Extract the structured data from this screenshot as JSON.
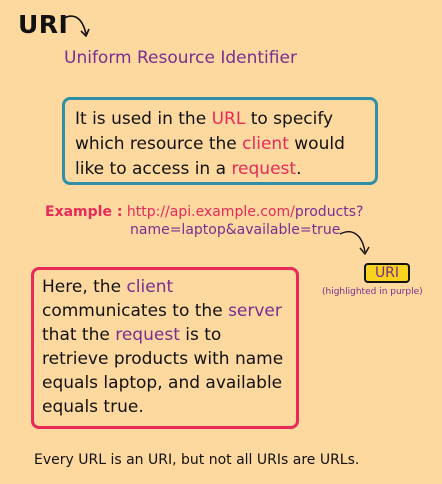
{
  "title": "URI",
  "subtitle": "Uniform Resource Identifier",
  "box1": {
    "t1": "It is used in the ",
    "url": "URL",
    "t2": " to specify which resource the ",
    "client": "client",
    "t3": " would like to access in a ",
    "request": "request",
    "t4": "."
  },
  "example": {
    "label": "Example :",
    "url_part1": "http://api.example.com/",
    "url_part2": "products?",
    "url_line2": "name=laptop&available=true"
  },
  "uri_badge": {
    "label": "URI",
    "note": "(highlighted in purple)"
  },
  "box2": {
    "t1": "Here, the ",
    "client": "client",
    "t2": " communicates to the ",
    "server": "server",
    "t3": " that the ",
    "request": "request",
    "t4": " is to retrieve products with name equals laptop, and available equals true."
  },
  "footer": "Every URL is an URI, but not all URIs are URLs.",
  "colors": {
    "background": "#fdd9a0",
    "red": "#e8295a",
    "purple": "#7b2c90",
    "teal": "#2f8fa6",
    "yellow": "#f7d21e"
  }
}
